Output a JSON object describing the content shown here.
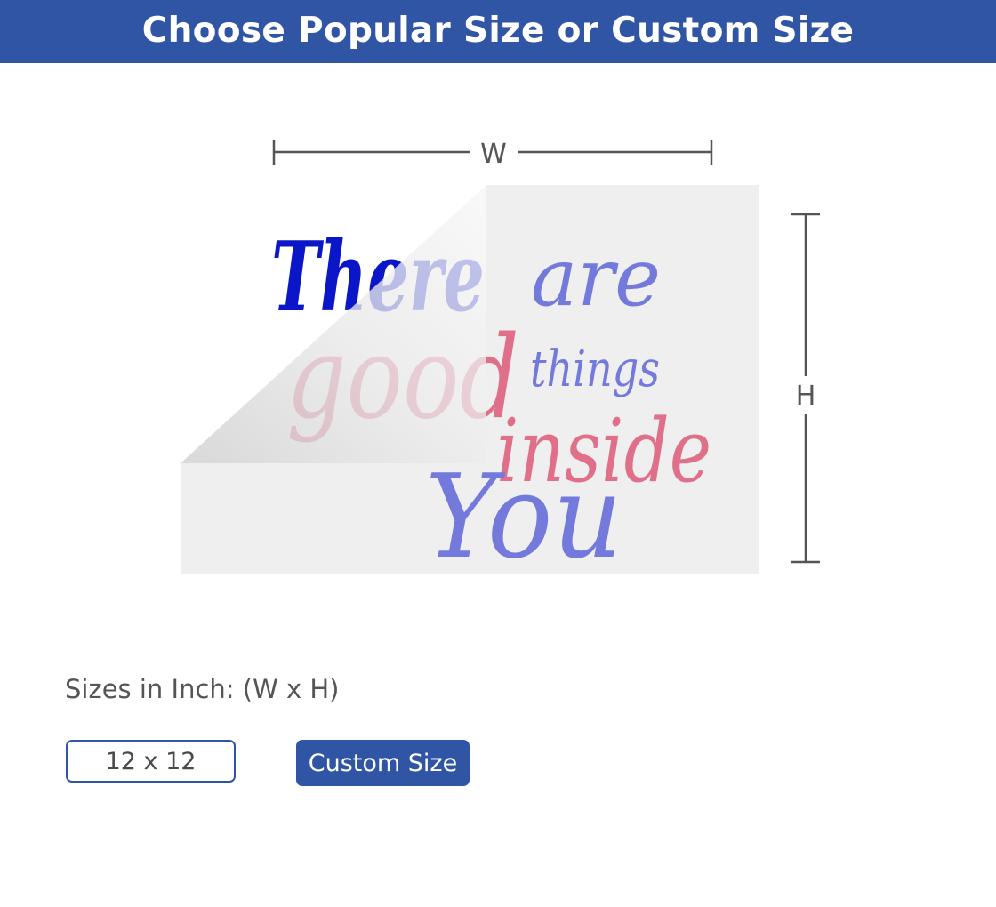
{
  "header": {
    "title": "Choose Popular Size or Custom Size"
  },
  "preview": {
    "width_label": "W",
    "height_label": "H",
    "sticker_text": {
      "line1_a": "There",
      "line1_b": "are",
      "line2_a": "good",
      "line2_b": "things",
      "line3": "inside",
      "line4": "You"
    }
  },
  "sizes": {
    "label": "Sizes in Inch: (W x H)",
    "options": [
      "12 x 12"
    ],
    "custom_label": "Custom Size"
  },
  "colors": {
    "brand": "#2f55a4",
    "sticker_bg": "#efefef",
    "text_blue": "#7479dc",
    "text_pink": "#e0708a",
    "text_dark_blue": "#0b16c9"
  }
}
